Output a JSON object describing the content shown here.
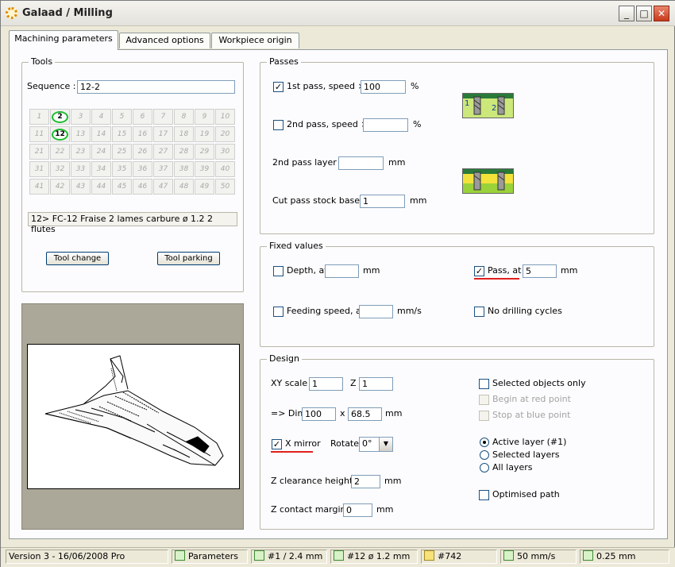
{
  "window": {
    "title": "Galaad / Milling",
    "minimize": "_",
    "maximize": "□",
    "close": "✕"
  },
  "tabs": [
    {
      "label": "Machining parameters",
      "active": true
    },
    {
      "label": "Advanced options"
    },
    {
      "label": "Workpiece origin"
    }
  ],
  "tools": {
    "legend": "Tools",
    "sequence_label": "Sequence :",
    "sequence_value": "12-2",
    "grid": [
      "1",
      "2",
      "3",
      "4",
      "5",
      "6",
      "7",
      "8",
      "9",
      "10",
      "11",
      "12",
      "13",
      "14",
      "15",
      "16",
      "17",
      "18",
      "19",
      "20",
      "21",
      "22",
      "23",
      "24",
      "25",
      "26",
      "27",
      "28",
      "29",
      "30",
      "31",
      "32",
      "33",
      "34",
      "35",
      "36",
      "37",
      "38",
      "39",
      "40",
      "41",
      "42",
      "43",
      "44",
      "45",
      "46",
      "47",
      "48",
      "49",
      "50"
    ],
    "selected": [
      "2",
      "12"
    ],
    "tool_desc": "12>  FC-12 Fraise 2 lames carbure   ø 1.2   2 flutes",
    "tool_change": "Tool change",
    "tool_parking": "Tool parking"
  },
  "passes": {
    "legend": "Passes",
    "first_pass_label": "1st pass, speed ×",
    "first_pass_value": "100",
    "first_pass_checked": true,
    "second_pass_label": "2nd pass, speed ×",
    "second_pass_value": "",
    "percent": "%",
    "layer_label": "2nd pass layer :",
    "layer_value": "",
    "cut_label": "Cut pass stock base :",
    "cut_value": "1",
    "mm": "mm",
    "illus_1": "1",
    "illus_2": "2"
  },
  "fixed": {
    "legend": "Fixed values",
    "depth_label": "Depth, at",
    "depth_value": "",
    "pass_label": "Pass, at",
    "pass_value": "5",
    "pass_checked": true,
    "feed_label": "Feeding speed, at",
    "feed_value": "",
    "feed_unit": "mm/s",
    "nodrill_label": "No drilling cycles",
    "mm": "mm"
  },
  "design": {
    "legend": "Design",
    "xy_label": "XY scale",
    "xy_value": "1",
    "z_label": "Z",
    "z_value": "1",
    "dim_label": "=> Dim.",
    "dim_x": "100",
    "dim_times": "x",
    "dim_y": "68.5",
    "mm": "mm",
    "xmirror_label": "X mirror",
    "xmirror_checked": true,
    "rotate_label": "Rotate",
    "rotate_value": "0°",
    "zclear_label": "Z clearance height :",
    "zclear_value": "2",
    "zcontact_label": "Z contact margin :",
    "zcontact_value": "0",
    "selected_only": "Selected objects only",
    "begin_red": "Begin at red point",
    "stop_blue": "Stop at blue point",
    "active_layer": "Active layer (#1)",
    "selected_layers": "Selected layers",
    "all_layers": "All layers",
    "optimised": "Optimised path"
  },
  "status": {
    "version": "Version 3 - 16/06/2008  Pro",
    "parameters": "Parameters",
    "layer": "#1 / 2.4 mm",
    "tool": "#12  ø 1.2 mm",
    "count": "#742",
    "speed": "50 mm/s",
    "step": "0.25 mm"
  },
  "colors": {
    "accent": "#e0201c",
    "tool_ring": "#1cbc2e"
  }
}
